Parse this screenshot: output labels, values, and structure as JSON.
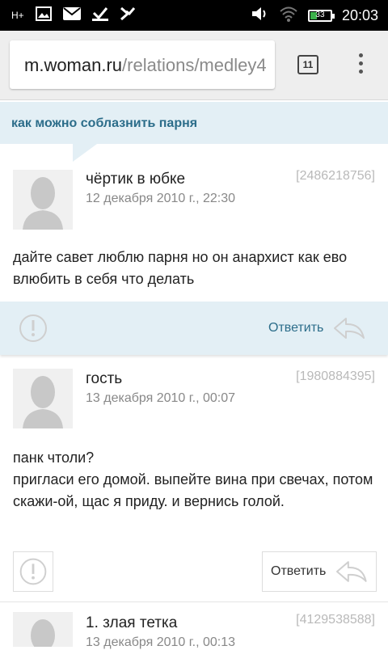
{
  "status_bar": {
    "signal_text": "H+",
    "battery_level": "33",
    "battery_fraction": 0.33,
    "time": "20:03",
    "icons": [
      "network-signal-icon",
      "image-icon",
      "mail-icon",
      "check-icon",
      "check-icon",
      "volume-icon",
      "wifi-icon",
      "battery-icon"
    ]
  },
  "browser": {
    "url_host": "m.woman.ru",
    "url_path": "/relations/medley4",
    "tab_count": "11"
  },
  "topic": {
    "title": "как можно соблазнить парня"
  },
  "comments": [
    {
      "author": "чёртик в юбке",
      "date": "12 декабря 2010 г., 22:30",
      "id": "[2486218756]",
      "body": "дайте савет люблю парня но он анархист как ево влюбить в себя что делать",
      "reply_label": "Ответить"
    },
    {
      "author": "гость",
      "date": "13 декабря 2010 г., 00:07",
      "id": "[1980884395]",
      "body": "панк чтоли?\nпригласи его домой. выпейте вина при свечах, потом скажи-ой, щас я приду. и вернись голой.",
      "reply_label": "Ответить"
    },
    {
      "author": "1. злая тетка",
      "date": "13 декабря 2010 г., 00:13",
      "id": "[4129538588]"
    }
  ],
  "colors": {
    "accent": "#2c6d8a",
    "highlight_bg": "#e3eff5"
  }
}
